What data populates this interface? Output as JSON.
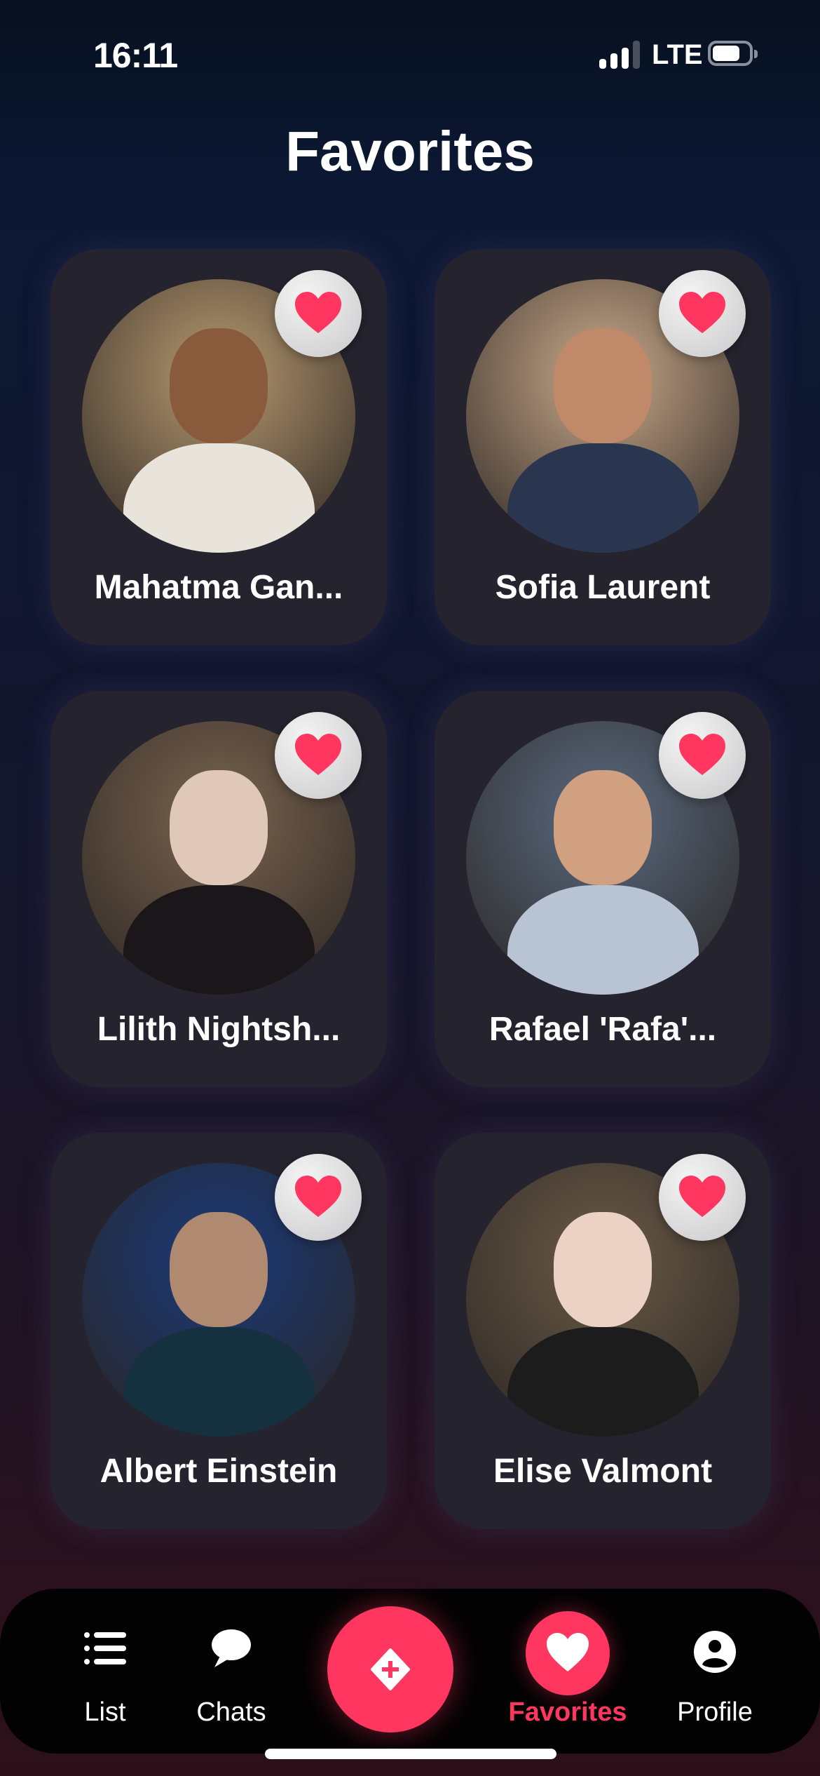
{
  "status_bar": {
    "time": "16:11",
    "network": "LTE",
    "signal_bars": 3,
    "battery_percent": 80
  },
  "page": {
    "title": "Favorites"
  },
  "favorites": [
    {
      "name": "Mahatma Gan...",
      "favorited": true,
      "colors": [
        "#b89a70",
        "#8a5a3c",
        "#e8e4dc"
      ]
    },
    {
      "name": "Sofia Laurent",
      "favorited": true,
      "colors": [
        "#c9a98a",
        "#c08a6a",
        "#2a3550"
      ]
    },
    {
      "name": "Lilith Nightsh...",
      "favorited": true,
      "colors": [
        "#7a6450",
        "#e0c8b8",
        "#1a161a"
      ]
    },
    {
      "name": "Rafael 'Rafa'...",
      "favorited": true,
      "colors": [
        "#5a6a80",
        "#d0a080",
        "#b8c4d4"
      ]
    },
    {
      "name": "Albert Einstein",
      "favorited": true,
      "colors": [
        "#1a3a7a",
        "#b08a70",
        "#15303f"
      ]
    },
    {
      "name": "Elise Valmont",
      "favorited": true,
      "colors": [
        "#6a5a48",
        "#ecd2c4",
        "#1c1c1c"
      ]
    }
  ],
  "tabbar": {
    "items": [
      {
        "label": "List",
        "icon": "list-icon"
      },
      {
        "label": "Chats",
        "icon": "chat-bubble-icon"
      },
      {
        "label": "Favorites",
        "icon": "heart-icon",
        "active": true
      },
      {
        "label": "Profile",
        "icon": "person-circle-icon"
      }
    ],
    "center_icon": "diamond-plus-icon"
  },
  "colors": {
    "accent": "#ff3660",
    "card": "#24232e",
    "tabbar": "#030203"
  }
}
